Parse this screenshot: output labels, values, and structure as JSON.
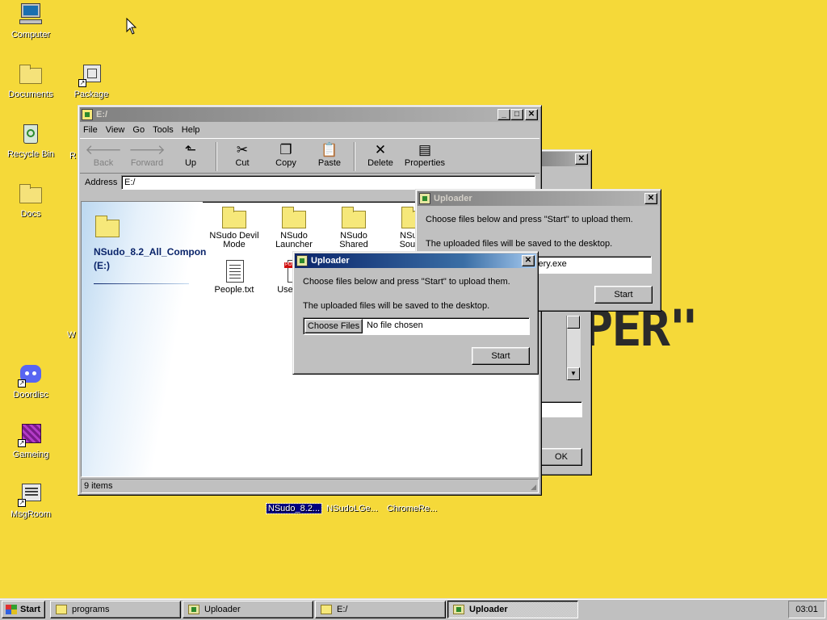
{
  "desktop": {
    "icons": [
      {
        "label": "Computer",
        "icon": "computer-icon"
      },
      {
        "label": "Documents",
        "icon": "folder-icon"
      },
      {
        "label": "Package",
        "icon": "package-icon"
      },
      {
        "label": "Recycle Bin",
        "icon": "recycle-bin-icon"
      },
      {
        "label": "Docs",
        "icon": "folder-icon"
      },
      {
        "label": "Doordisc",
        "icon": "doordisc-icon"
      },
      {
        "label": "Gameing",
        "icon": "game-cube-icon"
      },
      {
        "label": "MsgRoom",
        "icon": "msgroom-icon"
      },
      {
        "label": "NSudo_8.2...",
        "icon": "drive-icon"
      },
      {
        "label": "NSudoLGe...",
        "icon": "file-icon"
      },
      {
        "label": "ChromeRe...",
        "icon": "file-icon"
      }
    ],
    "partial_labels": {
      "left_r": "R",
      "left_w": "W"
    },
    "wallpaper_text": "PER\""
  },
  "explorer": {
    "title": "E:/",
    "menu": [
      "File",
      "View",
      "Go",
      "Tools",
      "Help"
    ],
    "toolbar": {
      "back": "Back",
      "forward": "Forward",
      "up": "Up",
      "cut": "Cut",
      "copy": "Copy",
      "paste": "Paste",
      "delete": "Delete",
      "properties": "Properties"
    },
    "address_label": "Address",
    "address_value": "E:/",
    "drive_name": "NSudo_8.2_All_Compon",
    "drive_letter": "(E:)",
    "files": [
      {
        "label": "NSudo Devil Mode",
        "type": "folder"
      },
      {
        "label": "NSudo Launcher",
        "type": "folder"
      },
      {
        "label": "NSudo Shared",
        "type": "folder"
      },
      {
        "label": "NSudo Source",
        "type": "folder"
      },
      {
        "label": "People.txt",
        "type": "text"
      },
      {
        "label": "UserM...",
        "type": "pdf"
      }
    ],
    "status": "9 items"
  },
  "uploader_back": {
    "title": "Uploader",
    "line1": "Choose files below and press \"Start\" to upload them.",
    "line2": "The uploaded files will be saved to the desktop.",
    "file_value": "very.exe",
    "start": "Start"
  },
  "uploader_front": {
    "title": "Uploader",
    "line1": "Choose files below and press \"Start\" to upload them.",
    "line2": "The uploaded files will be saved to the desktop.",
    "choose_button": "Choose Files",
    "file_value": "No file chosen",
    "start": "Start"
  },
  "behind_window": {
    "ok": "OK"
  },
  "taskbar": {
    "start": "Start",
    "buttons": [
      {
        "label": "programs",
        "icon": "folder-icon"
      },
      {
        "label": "Uploader",
        "icon": "uploader-icon"
      },
      {
        "label": "E:/",
        "icon": "folder-icon"
      },
      {
        "label": "Uploader",
        "icon": "uploader-icon"
      }
    ],
    "clock": "03:01"
  }
}
